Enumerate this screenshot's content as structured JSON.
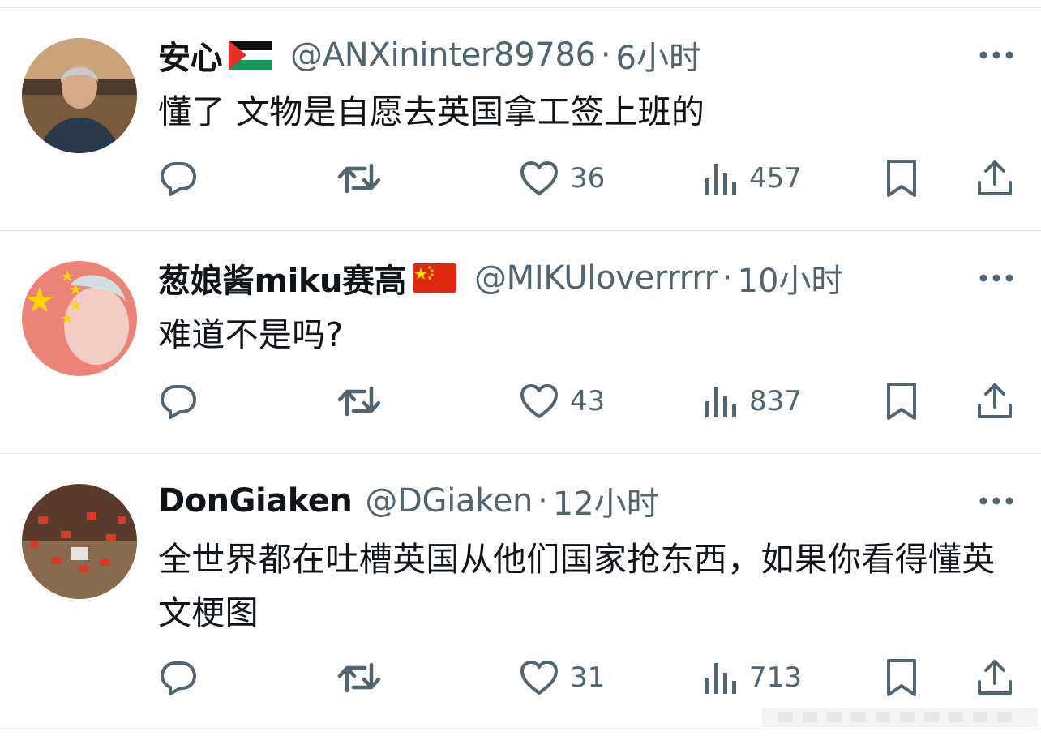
{
  "tweets": [
    {
      "name": "安心",
      "flag": "palestine-flag",
      "handle": "@ANXininter89786",
      "separator": "·",
      "time": "6小时",
      "text": "懂了 文物是自愿去英国拿工签上班的",
      "likes": "36",
      "views": "457"
    },
    {
      "name": "葱娘酱miku赛高",
      "flag": "china-flag",
      "handle": "@MIKUloverrrrr",
      "separator": "·",
      "time": "10小时",
      "text": "难道不是吗?",
      "likes": "43",
      "views": "837"
    },
    {
      "name": "DonGiaken",
      "flag": "",
      "handle": "@DGiaken",
      "separator": "·",
      "time": "12小时",
      "text": "全世界都在吐槽英国从他们国家抢东西，如果你看得懂英文梗图",
      "likes": "31",
      "views": "713"
    }
  ],
  "icons": {
    "reply": "reply-icon",
    "retweet": "retweet-icon",
    "like": "heart-icon",
    "views": "views-icon",
    "bookmark": "bookmark-icon",
    "share": "share-icon",
    "more": "more-icon"
  },
  "colors": {
    "text": "#0f1419",
    "secondary": "#536471",
    "separator": "#e3e6e8"
  }
}
